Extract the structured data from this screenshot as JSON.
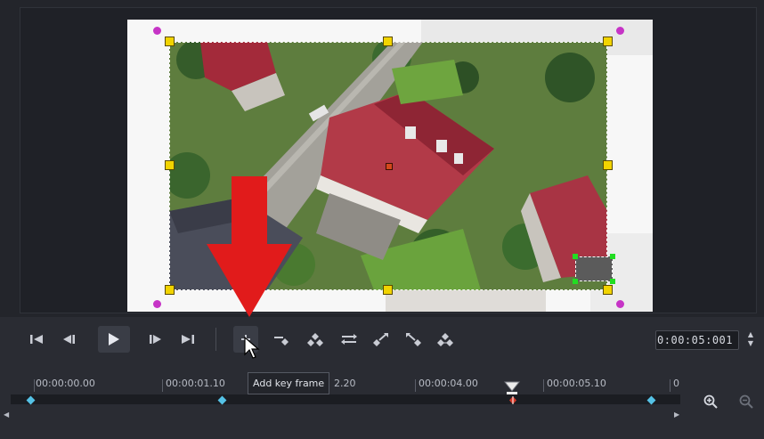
{
  "transport": {
    "go_start": "go-to-start-icon",
    "prev_frame": "previous-frame-icon",
    "play": "play-icon",
    "next_frame": "next-frame-icon",
    "go_end": "go-to-end-icon"
  },
  "keyframe_tools": {
    "add": "add-keyframe-icon",
    "remove": "remove-keyframe-icon",
    "reverse": "reverse-keyframes-icon",
    "move_left": "move-keyframe-left-icon",
    "first": "go-to-first-keyframe-icon",
    "previous": "go-to-previous-keyframe-icon",
    "next": "go-to-next-keyframe-icon"
  },
  "timecode": "0:00:05:001",
  "tooltip": "Add key frame",
  "timeline": {
    "labels": [
      "00:00:00.00",
      "00:00:01.10",
      "2.20",
      "00:00:04.00",
      "00:00:05.10",
      "0"
    ],
    "zoom_in_icon": "zoom-in-icon",
    "zoom_out_icon": "zoom-out-icon"
  },
  "colors": {
    "handle": "#f2d400",
    "rotate_handle": "#c634c6",
    "keyframe": "#55c2e6",
    "arrow": "#e11b1b"
  }
}
